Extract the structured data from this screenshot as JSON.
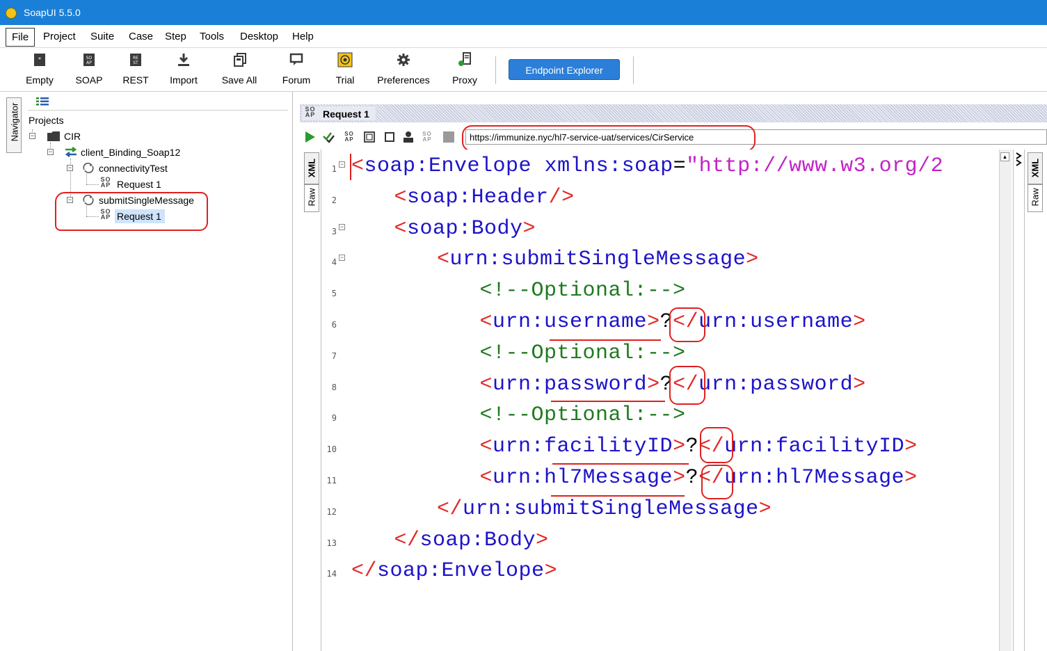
{
  "window": {
    "title": "SoapUI 5.5.0"
  },
  "menu": [
    "File",
    "Project",
    "Suite",
    "Case",
    "Step",
    "Tools",
    "Desktop",
    "Help"
  ],
  "toolbar": {
    "buttons": [
      {
        "label": "Empty",
        "icon": "empty-project-icon"
      },
      {
        "label": "SOAP",
        "icon": "soap-project-icon"
      },
      {
        "label": "REST",
        "icon": "rest-project-icon"
      },
      {
        "label": "Import",
        "icon": "import-icon"
      },
      {
        "label": "Save All",
        "icon": "save-all-icon"
      },
      {
        "label": "Forum",
        "icon": "forum-icon"
      },
      {
        "label": "Trial",
        "icon": "trial-icon"
      },
      {
        "label": "Preferences",
        "icon": "gear-icon"
      },
      {
        "label": "Proxy",
        "icon": "proxy-icon"
      }
    ],
    "endpoint_explorer": "Endpoint Explorer"
  },
  "navigator": {
    "tab_label": "Navigator",
    "root": "Projects",
    "project": "CIR",
    "binding": "client_Binding_Soap12",
    "operations": [
      {
        "name": "connectivityTest",
        "request": "Request 1"
      },
      {
        "name": "submitSingleMessage",
        "request": "Request 1"
      }
    ],
    "soap_badge_top": "SO",
    "soap_badge_bottom": "AP"
  },
  "request": {
    "title": "Request 1",
    "url": "https://immunize.nyc/hl7-service-uat/services/CirService",
    "left_tabs": [
      "XML",
      "Raw"
    ],
    "right_tabs": [
      "XML",
      "Raw"
    ],
    "code_lines": [
      {
        "n": "1",
        "indent": 0,
        "parts": [
          [
            "br",
            "<"
          ],
          [
            "tag",
            "soap:Envelope"
          ],
          [
            "txt",
            " "
          ],
          [
            "attr",
            "xmlns:soap"
          ],
          [
            "txt",
            "="
          ],
          [
            "val",
            "\"http://www.w3.org/2"
          ]
        ]
      },
      {
        "n": "2",
        "indent": 1,
        "parts": [
          [
            "br",
            "<"
          ],
          [
            "tag",
            "soap:Header"
          ],
          [
            "br",
            "/>"
          ]
        ]
      },
      {
        "n": "3",
        "indent": 1,
        "parts": [
          [
            "br",
            "<"
          ],
          [
            "tag",
            "soap:Body"
          ],
          [
            "br",
            ">"
          ]
        ]
      },
      {
        "n": "4",
        "indent": 2,
        "parts": [
          [
            "br",
            "<"
          ],
          [
            "tag",
            "urn:submitSingleMessage"
          ],
          [
            "br",
            ">"
          ]
        ]
      },
      {
        "n": "5",
        "indent": 3,
        "parts": [
          [
            "cmt",
            "<!--Optional:-->"
          ]
        ]
      },
      {
        "n": "6",
        "indent": 3,
        "parts": [
          [
            "br",
            "<"
          ],
          [
            "tag",
            "urn:username"
          ],
          [
            "br",
            ">"
          ],
          [
            "txt",
            "?"
          ],
          [
            "br",
            "</"
          ],
          [
            "tag",
            "urn:username"
          ],
          [
            "br",
            ">"
          ]
        ]
      },
      {
        "n": "7",
        "indent": 3,
        "parts": [
          [
            "cmt",
            "<!--Optional:-->"
          ]
        ]
      },
      {
        "n": "8",
        "indent": 3,
        "parts": [
          [
            "br",
            "<"
          ],
          [
            "tag",
            "urn:password"
          ],
          [
            "br",
            ">"
          ],
          [
            "txt",
            "?"
          ],
          [
            "br",
            "</"
          ],
          [
            "tag",
            "urn:password"
          ],
          [
            "br",
            ">"
          ]
        ]
      },
      {
        "n": "9",
        "indent": 3,
        "parts": [
          [
            "cmt",
            "<!--Optional:-->"
          ]
        ]
      },
      {
        "n": "10",
        "indent": 3,
        "parts": [
          [
            "br",
            "<"
          ],
          [
            "tag",
            "urn:facilityID"
          ],
          [
            "br",
            ">"
          ],
          [
            "txt",
            "?"
          ],
          [
            "br",
            "</"
          ],
          [
            "tag",
            "urn:facilityID"
          ],
          [
            "br",
            ">"
          ]
        ]
      },
      {
        "n": "11",
        "indent": 3,
        "parts": [
          [
            "br",
            "<"
          ],
          [
            "tag",
            "urn:hl7Message"
          ],
          [
            "br",
            ">"
          ],
          [
            "txt",
            "?"
          ],
          [
            "br",
            "</"
          ],
          [
            "tag",
            "urn:hl7Message"
          ],
          [
            "br",
            ">"
          ]
        ]
      },
      {
        "n": "12",
        "indent": 2,
        "parts": [
          [
            "br",
            "</"
          ],
          [
            "tag",
            "urn:submitSingleMessage"
          ],
          [
            "br",
            ">"
          ]
        ]
      },
      {
        "n": "13",
        "indent": 1,
        "parts": [
          [
            "br",
            "</"
          ],
          [
            "tag",
            "soap:Body"
          ],
          [
            "br",
            ">"
          ]
        ]
      },
      {
        "n": "14",
        "indent": 0,
        "parts": [
          [
            "br",
            "</"
          ],
          [
            "tag",
            "soap:Envelope"
          ],
          [
            "br",
            ">"
          ]
        ]
      }
    ]
  }
}
